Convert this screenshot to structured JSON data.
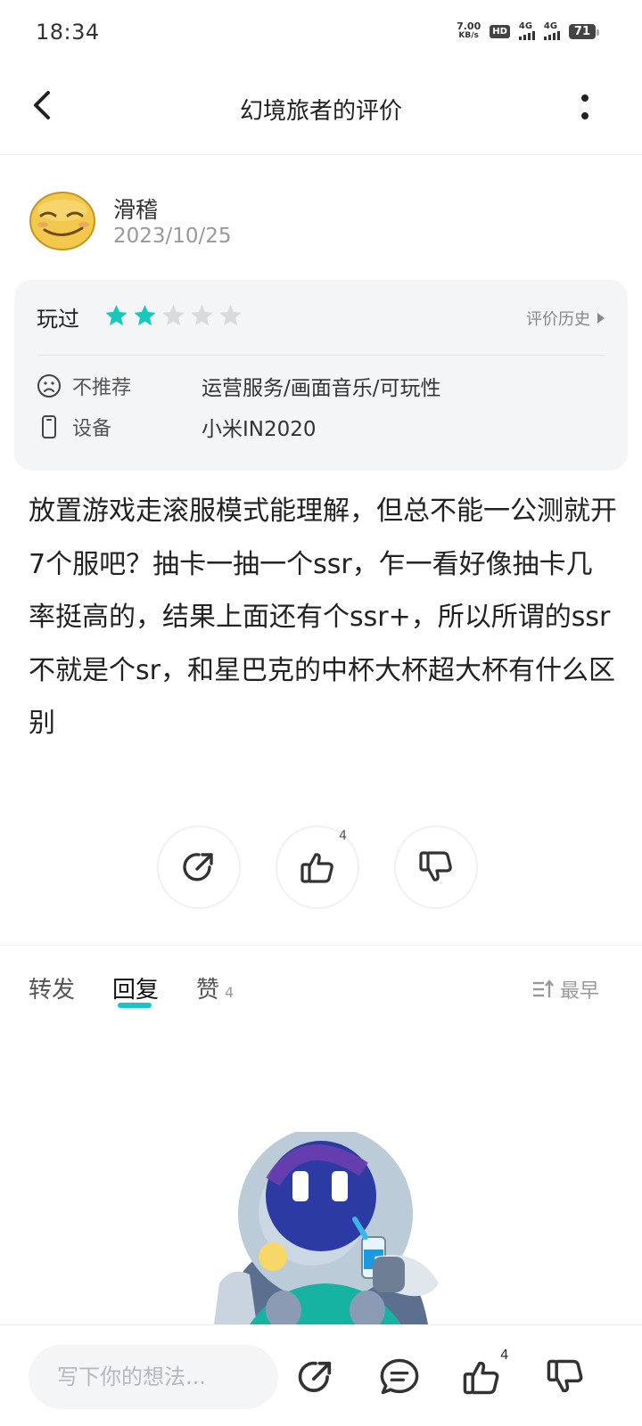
{
  "status_bar": {
    "time": "18:34",
    "net_speed_value": "7.00",
    "net_speed_unit": "KB/s",
    "hd_label": "HD",
    "sim1_label": "4G",
    "sim2_label": "4G",
    "battery": "71"
  },
  "header": {
    "title": "幻境旅者的评价",
    "back_icon": "chevron-left-icon",
    "more_icon": "vertical-dots-icon"
  },
  "user": {
    "name": "滑稽",
    "date": "2023/10/25",
    "avatar_icon": "funny-face-avatar"
  },
  "rating_card": {
    "status_label": "玩过",
    "rating": 2,
    "max_rating": 5,
    "star_color": "#18c8ba",
    "history_label": "评价历史",
    "rows": [
      {
        "icon": "frown-face-icon",
        "key": "不推荐",
        "value": "运营服务/画面音乐/可玩性"
      },
      {
        "icon": "phone-device-icon",
        "key": "设备",
        "value": "小米IN2020"
      }
    ]
  },
  "review": {
    "text": "放置游戏走滚服模式能理解，但总不能一公测就开7个服吧？抽卡一抽一个ssr，乍一看好像抽卡几率挺高的，结果上面还有个ssr+，所以所谓的ssr不就是个sr，和星巴克的中杯大杯超大杯有什么区别"
  },
  "actions": {
    "share_icon": "share-arrow-icon",
    "like_icon": "thumbs-up-icon",
    "like_count": "4",
    "dislike_icon": "thumbs-down-icon"
  },
  "tabs": {
    "items": [
      {
        "label": "转发",
        "count": ""
      },
      {
        "label": "回复",
        "count": ""
      },
      {
        "label": "赞",
        "count": "4"
      }
    ],
    "active": "回复",
    "accent_color": "#15c5ce",
    "sort_label": "最早",
    "sort_icon": "sort-ascending-icon"
  },
  "empty_state": {
    "illustration": "astronaut-mascot-with-drink"
  },
  "bottom_bar": {
    "input_placeholder": "写下你的想法...",
    "like_count": "4",
    "icons": [
      "share-arrow-icon",
      "comment-bubble-icon",
      "thumbs-up-icon",
      "thumbs-down-icon"
    ]
  }
}
